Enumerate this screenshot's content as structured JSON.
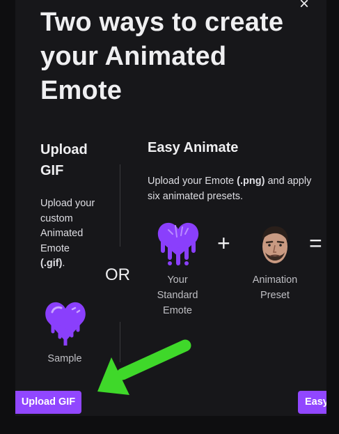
{
  "dialog": {
    "title": "Two ways to create your Animated Emote",
    "close_label": "×"
  },
  "upload_gif": {
    "title": "Upload GIF",
    "description_line1": "Upload your custom Animated Emote",
    "description_ext": "(.gif)",
    "description_end": ".",
    "sample_label": "Sample",
    "button_label": "Upload GIF"
  },
  "separator": {
    "label": "OR"
  },
  "easy_animate": {
    "title": "Easy Animate",
    "description_pre": "Upload your Emote ",
    "description_ext": "(.png)",
    "description_post": " and apply",
    "description_line2": "six animated presets.",
    "standard_emote_label": "Your Standard Emote",
    "plus": "+",
    "animation_preset_label": "Animation Preset",
    "equals": "=",
    "button_label": "Easy Animate"
  },
  "colors": {
    "background": "#17171a",
    "accent": "#9147ff",
    "emote": "#8a3ffc",
    "annotation_arrow": "#3fd82a"
  },
  "icons": {
    "sample_emote": "dripping-heart-icon",
    "standard_emote": "dripping-heart-icon",
    "animation_preset": "streamer-face-avatar"
  }
}
